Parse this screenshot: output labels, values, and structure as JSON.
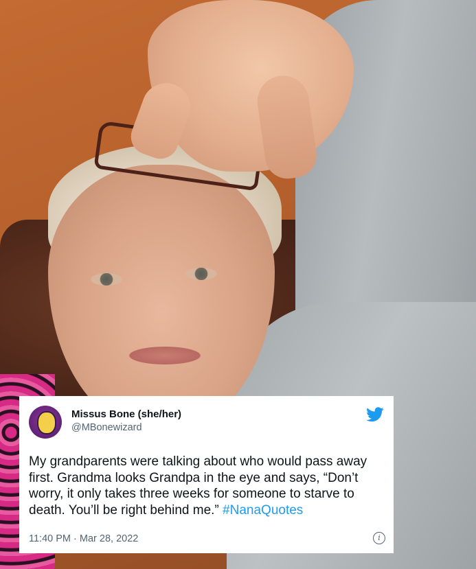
{
  "tweet": {
    "display_name": "Missus Bone (she/her)",
    "handle": "@MBonewizard",
    "text": "My grandparents were talking about who would pass away first. Grandma looks Grandpa in the eye and says, “Don’t worry, it only takes three weeks for someone to starve to death. You’ll be right behind me.”",
    "hashtag": "#NanaQuotes",
    "time": "11:40 PM",
    "separator": "·",
    "date": "Mar 28, 2022",
    "icons": {
      "brand": "twitter-bird-icon",
      "info": "info-icon"
    },
    "colors": {
      "link": "#1d9bf0",
      "text": "#0f1419",
      "secondary": "#536471"
    }
  }
}
